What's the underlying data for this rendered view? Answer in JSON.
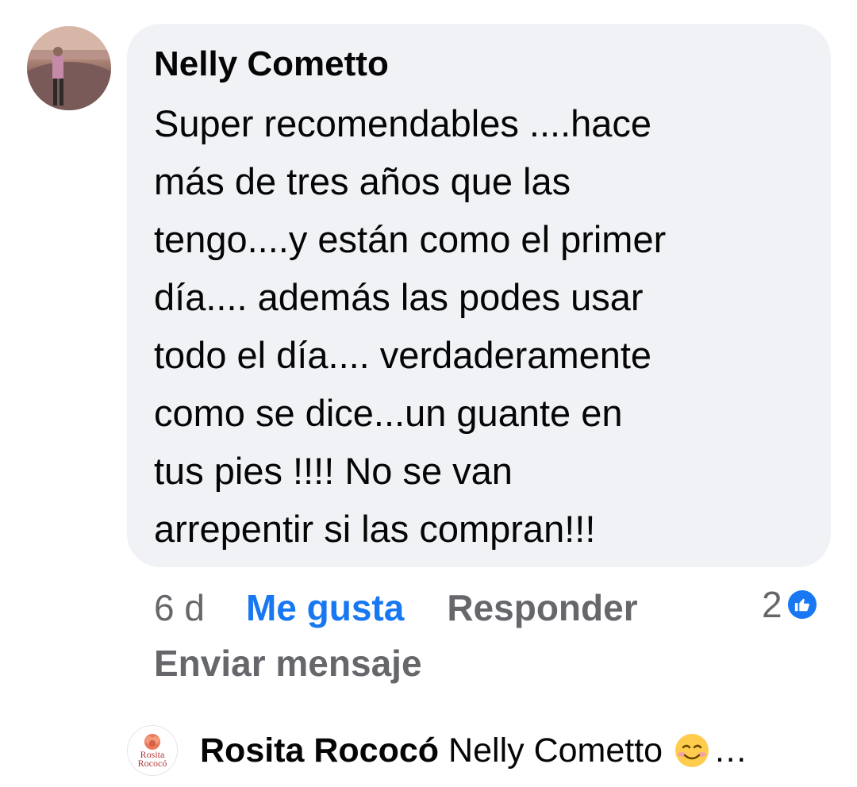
{
  "comment": {
    "author": "Nelly Cometto",
    "text": "Super recomendables ....hace\nmás de tres años que las\ntengo....y están como el primer\ndía.... además las podes usar\ntodo el día.... verdaderamente\ncomo se dice...un guante en\ntus pies !!!! No se van\narrepentir si las compran!!!",
    "avatar_icon": "profile-photo-landscape"
  },
  "actions": {
    "time": "6 d",
    "like_label": "Me gusta",
    "reply_label": "Responder",
    "send_message_label": "Enviar mensaje",
    "reaction_count": "2",
    "reaction_icon": "like-thumbs-up"
  },
  "reply_preview": {
    "author": "Rosita Rococó",
    "text": "Nelly Cometto",
    "emoji": "smiling-face-with-smiling-eyes",
    "ellipsis": "…",
    "avatar_logo_line1": "Rosita",
    "avatar_logo_line2": "Rococó"
  },
  "colors": {
    "bubble": "#f0f2f5",
    "like_active": "#1877f2",
    "secondary_text": "#65676b",
    "primary_text": "#050505"
  }
}
